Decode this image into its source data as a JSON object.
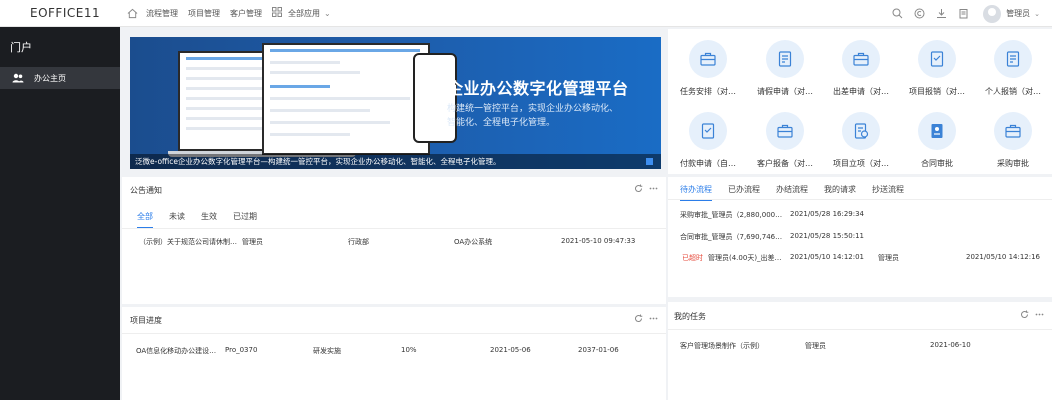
{
  "app": {
    "logo": "EOFFICE11",
    "nav": [
      "流程管理",
      "项目管理",
      "客户管理"
    ],
    "all_apps": "全部应用",
    "user": "管理员"
  },
  "sidebar": {
    "title": "门户",
    "items": [
      {
        "label": "办公主页"
      }
    ]
  },
  "banner": {
    "title": "企业办公数字化管理平台",
    "sub1": "构建统一管控平台，实现企业办公移动化、",
    "sub2": "智能化、全程电子化管理。",
    "caption": "泛微e-office企业办公数字化管理平台—构建统一管控平台，实现企业办公移动化、智能化、全程电子化管理。"
  },
  "shortcuts": [
    {
      "label": "任务安排（对…",
      "icon": "briefcase-icon"
    },
    {
      "label": "请假申请（对…",
      "icon": "form-icon"
    },
    {
      "label": "出差申请（对…",
      "icon": "briefcase-icon"
    },
    {
      "label": "项目报销（对…",
      "icon": "edit-doc-icon"
    },
    {
      "label": "个人报销（对…",
      "icon": "form-icon"
    },
    {
      "label": "付款申请（自…",
      "icon": "edit-doc-icon"
    },
    {
      "label": "客户报备（对…",
      "icon": "briefcase-icon"
    },
    {
      "label": "项目立项（对…",
      "icon": "doc-clock-icon"
    },
    {
      "label": "合同审批",
      "icon": "contract-icon"
    },
    {
      "label": "采购审批",
      "icon": "briefcase-icon"
    }
  ],
  "notice": {
    "title": "公告通知",
    "tabs": [
      "全部",
      "未读",
      "生效",
      "已过期"
    ],
    "rows": [
      {
        "title": "（示例）关于规范公司请休制…",
        "author": "管理员",
        "dept": "行政部",
        "category": "OA办公系统",
        "time": "2021-05-10 09:47:33"
      }
    ]
  },
  "workflow": {
    "tabs": [
      "待办流程",
      "已办流程",
      "办结流程",
      "我的请求",
      "抄送流程"
    ],
    "rows": [
      {
        "tag": "",
        "title": "采购审批_管理员（2,880,000…",
        "time": "2021/05/28 16:29:34",
        "user": "",
        "date": ""
      },
      {
        "tag": "",
        "title": "合同审批_管理员（7,690,746…",
        "time": "2021/05/28 15:50:11",
        "user": "",
        "date": ""
      },
      {
        "tag": "已超时",
        "title": "管理员(4.00天)_出差…",
        "time": "2021/05/10 14:12:01",
        "user": "管理员",
        "date": "2021/05/10 14:12:16"
      }
    ]
  },
  "project": {
    "title": "项目进度",
    "rows": [
      {
        "name": "OA信息化移动办公建设…",
        "code": "Pro_0370",
        "stage": "研发实施",
        "progress": "10%",
        "start": "2021-05-06",
        "end": "2037-01-06"
      }
    ]
  },
  "tasks": {
    "title": "我的任务",
    "rows": [
      {
        "name": "客户管理场景制作（示例）",
        "owner": "管理员",
        "date": "2021-06-10"
      }
    ]
  }
}
